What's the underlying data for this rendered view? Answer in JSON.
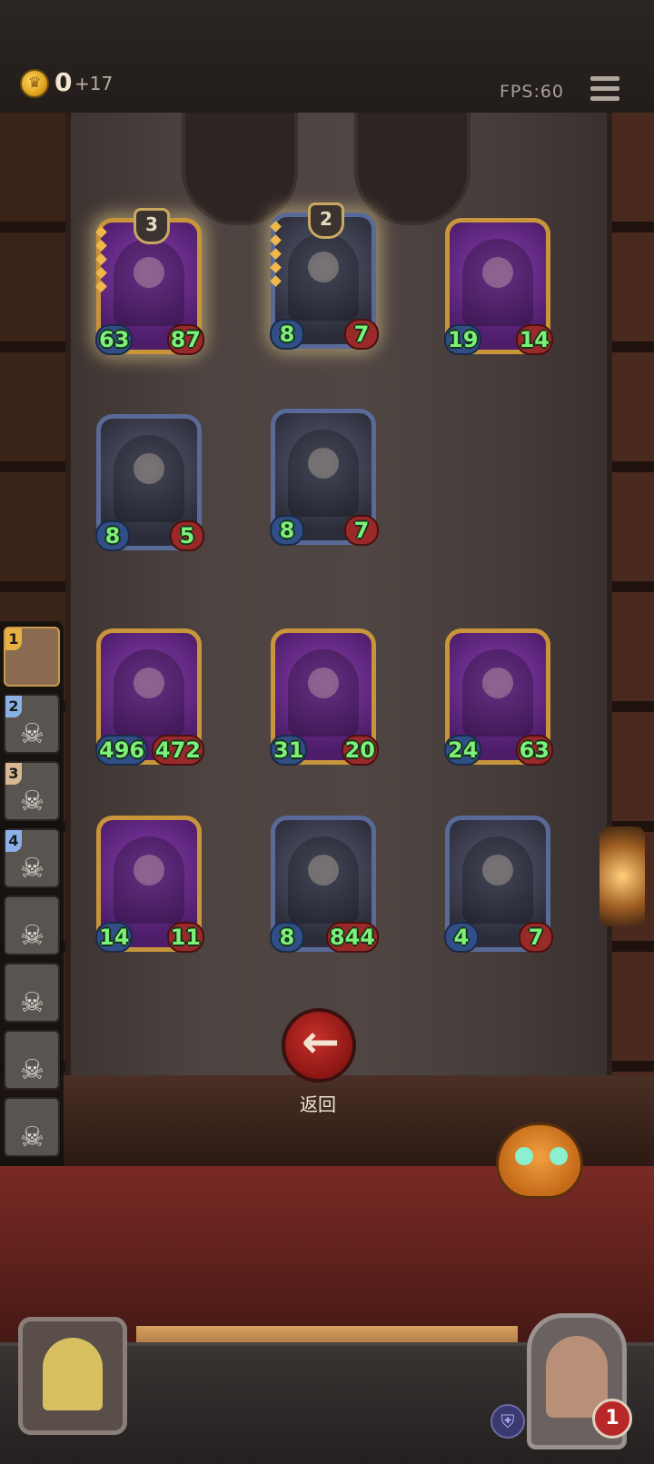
{
  "header": {
    "coins": "0",
    "coin_income": "+17",
    "fps_label": "FPS:60",
    "menu_icon": "hamburger-menu-icon"
  },
  "board": {
    "cards": [
      {
        "atk": "63",
        "hp": "87",
        "tier": "3",
        "frame": "gold",
        "glow": true
      },
      {
        "atk": "8",
        "hp": "7",
        "tier": "2",
        "frame": "blue",
        "glow": true
      },
      {
        "atk": "19",
        "hp": "14",
        "frame": "gold"
      },
      {
        "atk": "8",
        "hp": "5",
        "frame": "blue"
      },
      {
        "atk": "8",
        "hp": "7",
        "frame": "blue"
      },
      {
        "atk": "496",
        "hp": "472",
        "frame": "gold"
      },
      {
        "atk": "31",
        "hp": "20",
        "frame": "gold"
      },
      {
        "atk": "24",
        "hp": "63",
        "frame": "gold"
      },
      {
        "atk": "14",
        "hp": "11",
        "frame": "gold"
      },
      {
        "atk": "8",
        "hp": "844",
        "frame": "blue"
      },
      {
        "atk": "4",
        "hp": "7",
        "frame": "blue"
      }
    ],
    "back_label": "返回"
  },
  "roster": {
    "slots": [
      {
        "num": "1"
      },
      {
        "num": "2"
      },
      {
        "num": "3"
      },
      {
        "num": "4"
      },
      {
        "num": ""
      },
      {
        "num": ""
      },
      {
        "num": ""
      },
      {
        "num": ""
      }
    ]
  },
  "player": {
    "lives": "1"
  }
}
